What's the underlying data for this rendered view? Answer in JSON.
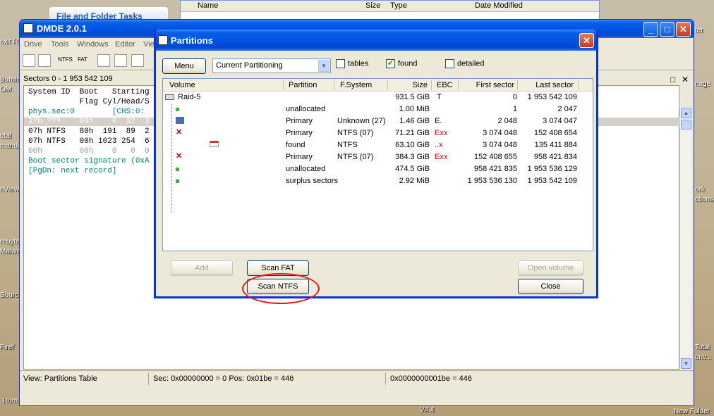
{
  "background": {
    "folder_tasks": "File and Folder Tasks",
    "columns": {
      "name": "Name",
      "size": "Size",
      "type": "Type",
      "date": "Date Modified"
    },
    "desktop_labels": [
      "oxit R",
      "Burnin",
      "OM",
      "otal",
      "mande",
      "nView",
      "rebyte",
      "Malwa",
      "Sourc",
      "Firef",
      "Hom",
      "ter",
      "nage",
      "ork",
      "ctions",
      "Total",
      "onv...",
      "New Folder"
    ],
    "version": "V4.4"
  },
  "main": {
    "title": "DMDE 2.0.1",
    "menu": [
      "Drive",
      "Tools",
      "Windows",
      "Editor",
      "Vie"
    ],
    "toolbar_labels": [
      "NTFS",
      "FAT"
    ],
    "sectors": "Sectors 0 - 1 953 542 109",
    "pane_lines": [
      "System ID  Boot   Starting",
      "           Flag Cyl/Head/S",
      "phys.sec:0        [CHS:0:",
      "27h ???    00h    0  32  3",
      "07h NTFS   80h  191  89  2",
      "07h NTFS   00h 1023 254  6",
      "00h        00h    0   0  0",
      "Boot sector signature (0xA",
      "[PgDn: next record]"
    ],
    "status": {
      "view": "View: Partitions Table",
      "sec": "Sec: 0x00000000 = 0  Pos: 0x01be = 446",
      "hex": "0x0000000001be = 446"
    }
  },
  "dialog": {
    "title": "Partitions",
    "menu_button": "Menu",
    "combo_value": "Current Partitioning",
    "checkboxes": [
      {
        "label": "tables",
        "checked": false
      },
      {
        "label": "found",
        "checked": true
      },
      {
        "label": "detailed",
        "checked": false
      }
    ],
    "headers": [
      "Volume",
      "Partition",
      "F.System",
      "Size",
      "EBC",
      "First sector",
      "Last sector"
    ],
    "rows": [
      {
        "volume": "Raid-5",
        "partition": "",
        "fs": "",
        "size": "931.5 GiB",
        "ebc": "T",
        "first": "0",
        "last": "1 953 542 109"
      },
      {
        "volume": "",
        "partition": "unallocated",
        "fs": "",
        "size": "1.00 MiB",
        "ebc": "",
        "first": "1",
        "last": "2 047"
      },
      {
        "volume": "",
        "partition": "Primary",
        "fs": "Unknown (27)",
        "size": "1.46 GiB",
        "ebc": "E.",
        "first": "2 048",
        "last": "3 074 047"
      },
      {
        "volume": "",
        "partition": "Primary",
        "fs": "NTFS (07)",
        "size": "71.21 GiB",
        "ebc": "Exx",
        "first": "3 074 048",
        "last": "152 408 654"
      },
      {
        "volume": "",
        "partition": "found",
        "fs": "NTFS",
        "size": "63.10 GiB",
        "ebc": "..x",
        "first": "3 074 048",
        "last": "135 411 884"
      },
      {
        "volume": "",
        "partition": "Primary",
        "fs": "NTFS (07)",
        "size": "384.3 GiB",
        "ebc": "Exx",
        "first": "152 408 655",
        "last": "958 421 834"
      },
      {
        "volume": "",
        "partition": "unallocated",
        "fs": "",
        "size": "474.5 GiB",
        "ebc": "",
        "first": "958 421 835",
        "last": "1 953 536 129"
      },
      {
        "volume": "",
        "partition": "surplus sectors",
        "fs": "",
        "size": "2.92 MiB",
        "ebc": "",
        "first": "1 953 536 130",
        "last": "1 953 542 109"
      }
    ],
    "buttons": {
      "add": "Add",
      "scan_fat": "Scan FAT",
      "scan_ntfs": "Scan NTFS",
      "open_volume": "Open volume",
      "close": "Close"
    }
  }
}
